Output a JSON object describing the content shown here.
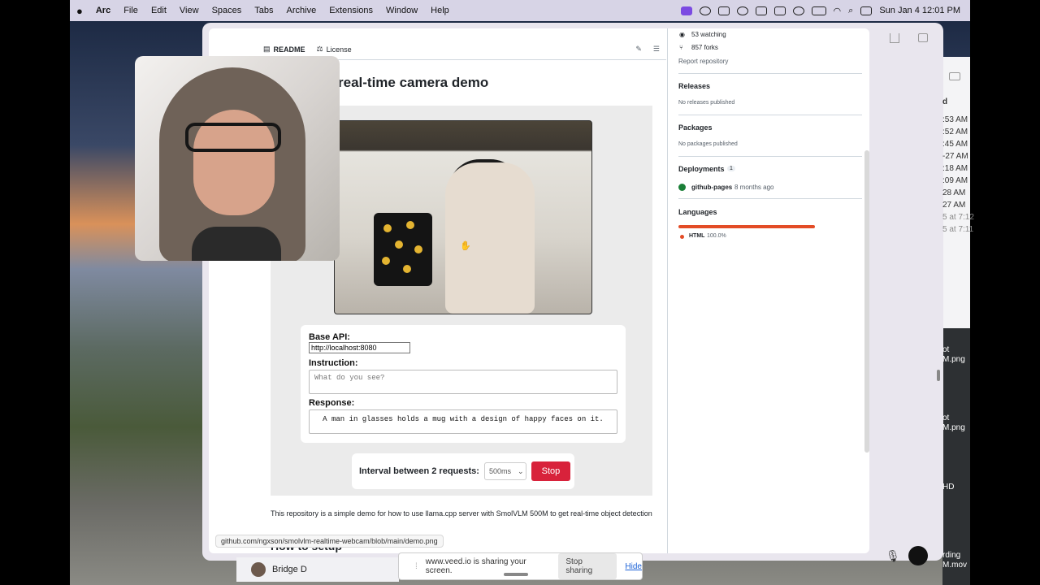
{
  "menubar": {
    "apple": "",
    "app": "Arc",
    "items": [
      "File",
      "Edit",
      "View",
      "Spaces",
      "Tabs",
      "Archive",
      "Extensions",
      "Window",
      "Help"
    ],
    "clock": "Sun Jan 4  12:01 PM"
  },
  "readme": {
    "tab_readme": "README",
    "tab_license": "License",
    "title": "real-time camera demo"
  },
  "demo_form": {
    "base_api_label": "Base API:",
    "base_api_value": "http://localhost:8080",
    "instruction_label": "Instruction:",
    "instruction_placeholder": "What do you see?",
    "response_label": "Response:",
    "response_value": "A man in glasses holds a mug with a design of happy faces on it.",
    "interval_label": "Interval between 2 requests:",
    "interval_value": "500ms",
    "stop_label": "Stop"
  },
  "description": "This repository is a simple demo for how to use llama.cpp server with SmolVLM 500M to get real-time object detection",
  "next_heading": "How to setup",
  "status_url": "github.com/ngxson/smolvlm-realtime-webcam/blob/main/demo.png",
  "sidebar": {
    "watching": "53 watching",
    "forks": "857 forks",
    "report": "Report repository",
    "releases_title": "Releases",
    "releases_sub": "No releases published",
    "packages_title": "Packages",
    "packages_sub": "No packages published",
    "deployments_title": "Deployments",
    "deployments_count": "1",
    "deploy_name": "github-pages",
    "deploy_time": "8 months ago",
    "languages_title": "Languages",
    "lang_name": "HTML",
    "lang_pct": "100.0%",
    "lang_color": "#e34c26"
  },
  "right_pane": {
    "header": "d",
    "times": [
      ":53 AM",
      ":52 AM",
      ":45 AM",
      "-27 AM",
      ":18 AM",
      ":09 AM",
      "28 AM",
      "27 AM",
      "5 at 7:12",
      "5 at 7:11"
    ],
    "file1a": "ot",
    "file1b": "M.png",
    "file2a": "ot",
    "file2b": "M.png",
    "hd": "HD",
    "file3a": "rding",
    "file3b": "M.mov"
  },
  "bottom": {
    "caller": "Bridge D",
    "share_text": "www.veed.io is sharing your screen.",
    "stop_sharing": "Stop sharing",
    "hide": "Hide"
  }
}
